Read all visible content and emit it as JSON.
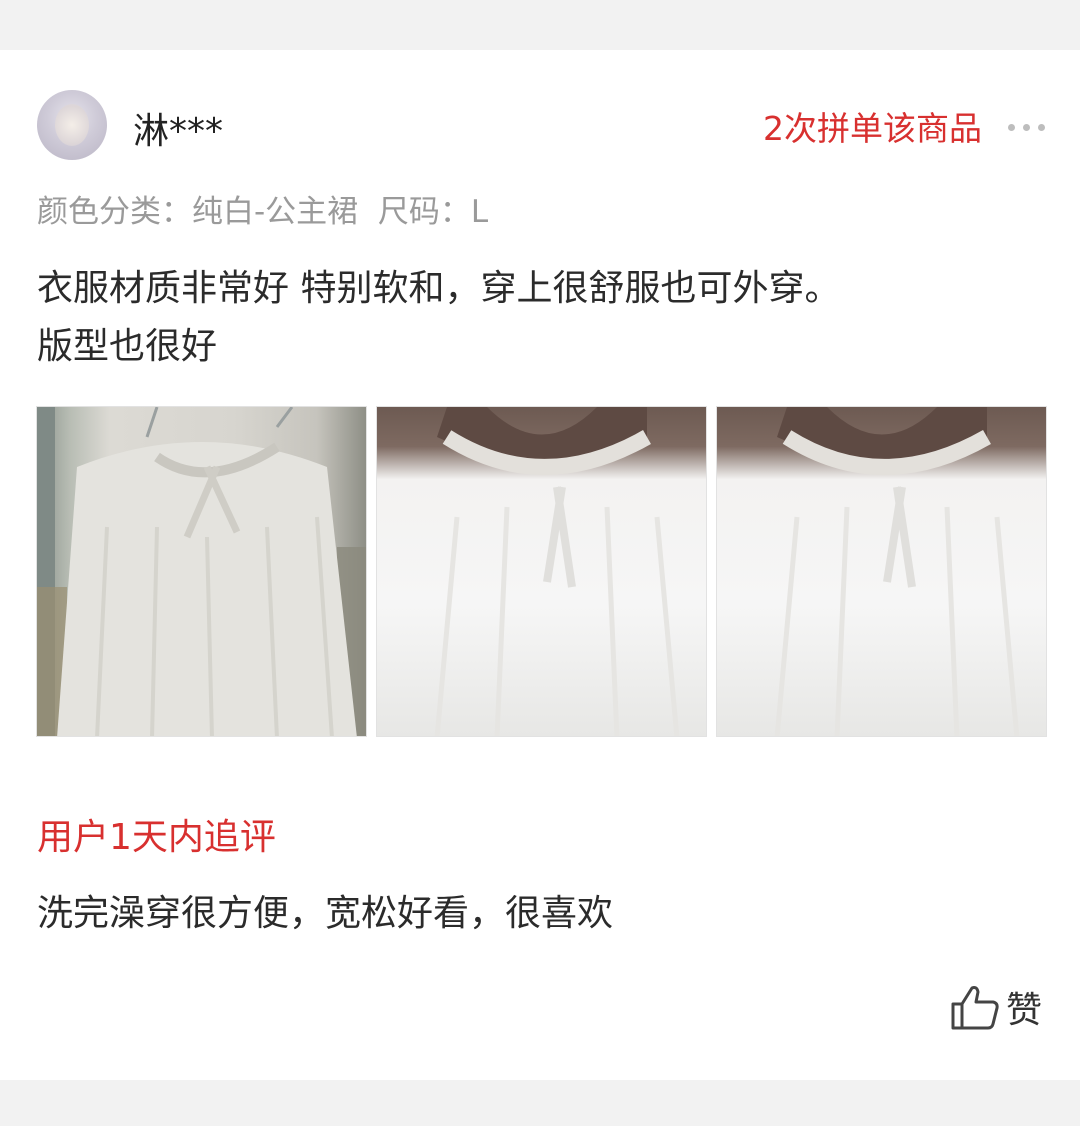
{
  "review": {
    "username": "淋***",
    "repeat_purchase": "2次拼单该商品",
    "sku": "颜色分类：纯白-公主裙  尺码：L",
    "comment_line1": "衣服材质非常好 特别软和，穿上很舒服也可外穿。",
    "comment_line2": "版型也很好",
    "photos": [
      "photo-hanging-dress",
      "photo-worn-front",
      "photo-worn-front-duplicate"
    ],
    "followup": {
      "title": "用户1天内追评",
      "text": "洗完澡穿很方便，宽松好看，很喜欢"
    },
    "like_label": "赞"
  },
  "colors": {
    "accent_red": "#d8302f",
    "muted_gray": "#9a9a9a",
    "background": "#f2f2f2"
  },
  "icons": [
    "avatar",
    "more-dots-icon",
    "thumbs-up-icon"
  ]
}
